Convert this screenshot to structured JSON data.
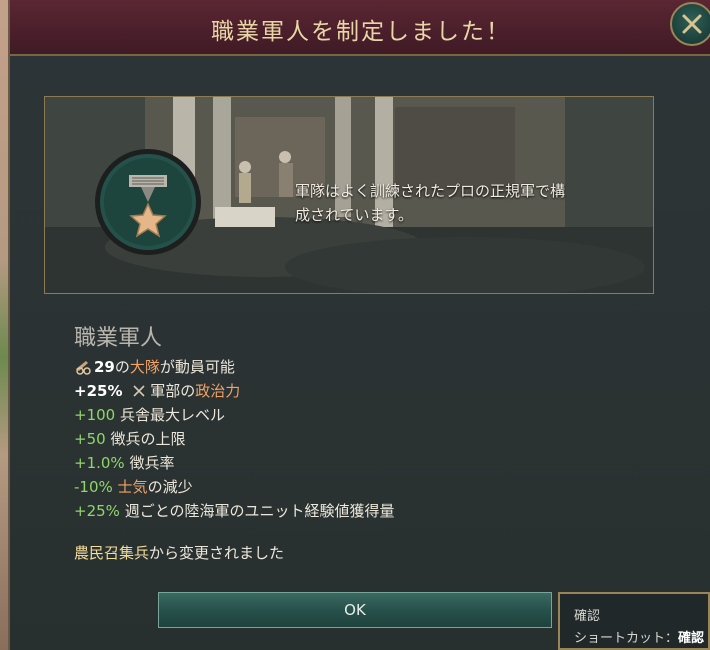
{
  "dialog": {
    "title": "職業軍人を制定しました！"
  },
  "banner": {
    "description_line1": "軍隊はよく訓練されたプロの正規軍で構",
    "description_line2": "成されています。"
  },
  "law": {
    "name": "職業軍人",
    "effects": [
      {
        "value": "29",
        "prefix": "の",
        "highlight": "大隊",
        "suffix": "が動員可能"
      },
      {
        "value": "+25%",
        "prefix": "軍部の",
        "highlight": "政治力",
        "suffix": ""
      },
      {
        "value": "+100",
        "text": "兵舎最大レベル"
      },
      {
        "value": "+50",
        "text": "徴兵の上限"
      },
      {
        "value": "+1.0%",
        "text": "徴兵率"
      },
      {
        "value": "-10%",
        "highlight": "士気",
        "suffix": "の減少"
      },
      {
        "value": "+25%",
        "text": "週ごとの陸海軍のユニット経験値獲得量"
      }
    ],
    "changed_from_name": "農民召集兵",
    "changed_from_suffix": "から変更されました"
  },
  "buttons": {
    "ok_label": "OK"
  },
  "tooltip": {
    "title": "確認",
    "shortcut_label": "ショートカット：",
    "shortcut_value": "確認"
  },
  "colors": {
    "title_text": "#e9d6a6",
    "positive": "#8fd66c",
    "negative": "#e58d74",
    "highlight": "#f2a167",
    "ok_button": "#27514b"
  },
  "icons": [
    "close-icon",
    "law-emblem-icon",
    "cannon-icon",
    "crossed-swords-icon"
  ]
}
